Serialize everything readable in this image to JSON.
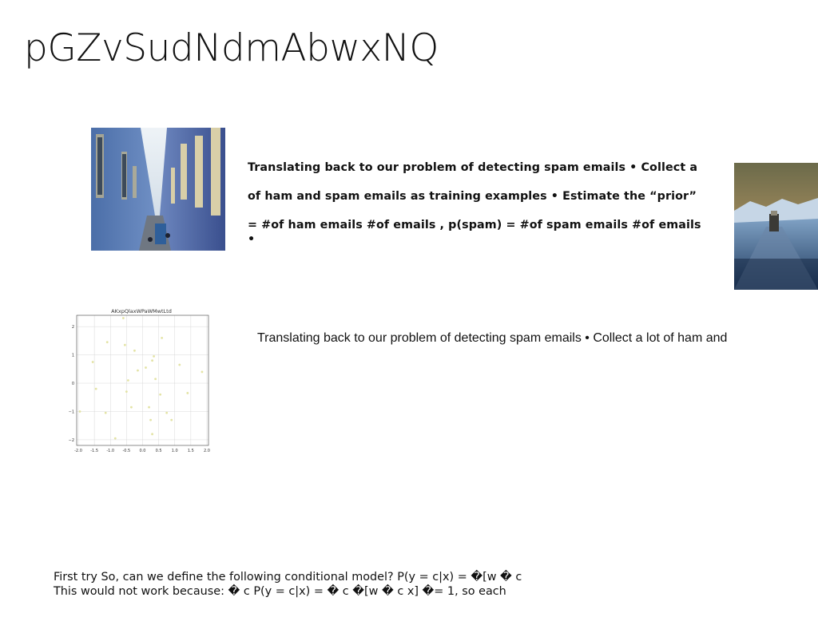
{
  "slide": {
    "title": "pGZvSudNdmAbwxNQ",
    "bold_lines": [
      "Translating back to our problem of detecting spam emails • Collect a",
      "of ham and spam emails as training examples • Estimate the “prior”",
      "= #of ham emails #of emails , p(spam) = #of spam emails #of emails •"
    ],
    "plain_text": "Translating back to our problem of detecting spam emails • Collect a lot of ham and",
    "footer_lines": [
      "First try So, can we define the following conditional model? P(y = c|x) = �[w � c",
      "This would not work because: � c P(y = c|x) = � c �[w � c x] �= 1, so each"
    ],
    "images": [
      {
        "name": "street-photo",
        "description_icon": "photo-icon"
      },
      {
        "name": "road-photo",
        "description_icon": "photo-icon"
      }
    ]
  },
  "chart_data": {
    "type": "scatter",
    "title": "AKxpQlaxWPaWMwtLtd",
    "xlim": [
      -2.05,
      2.05
    ],
    "ylim": [
      -2.2,
      2.4
    ],
    "xticks": [
      "-2.0",
      "-1.5",
      "-1.0",
      "-0.5",
      "0.0",
      "0.5",
      "1.0",
      "1.5",
      "2.0"
    ],
    "xtick_values": [
      -2.0,
      -1.5,
      -1.0,
      -0.5,
      0.0,
      0.5,
      1.0,
      1.5,
      2.0
    ],
    "yticks": [
      "2",
      "1",
      "0",
      "−1",
      "−2"
    ],
    "ytick_values": [
      2,
      1,
      0,
      -1,
      -2
    ],
    "grid": true,
    "point_color": "#e3e3a4",
    "points": [
      {
        "x": -1.95,
        "y": -1.0
      },
      {
        "x": -1.55,
        "y": 0.75
      },
      {
        "x": -1.45,
        "y": -0.2
      },
      {
        "x": -1.15,
        "y": -1.05
      },
      {
        "x": -1.1,
        "y": 1.45
      },
      {
        "x": -0.85,
        "y": -1.95
      },
      {
        "x": -0.6,
        "y": 2.3
      },
      {
        "x": -0.55,
        "y": 1.35
      },
      {
        "x": -0.5,
        "y": -0.3
      },
      {
        "x": -0.45,
        "y": 0.1
      },
      {
        "x": -0.35,
        "y": -0.85
      },
      {
        "x": -0.25,
        "y": 1.15
      },
      {
        "x": -0.15,
        "y": 0.45
      },
      {
        "x": 0.1,
        "y": 0.55
      },
      {
        "x": 0.2,
        "y": -0.85
      },
      {
        "x": 0.25,
        "y": -1.3
      },
      {
        "x": 0.3,
        "y": -1.8
      },
      {
        "x": 0.3,
        "y": 0.8
      },
      {
        "x": 0.35,
        "y": 0.95
      },
      {
        "x": 0.4,
        "y": 0.15
      },
      {
        "x": 0.55,
        "y": -0.4
      },
      {
        "x": 0.6,
        "y": 1.6
      },
      {
        "x": 0.75,
        "y": -1.05
      },
      {
        "x": 0.9,
        "y": -1.3
      },
      {
        "x": 1.15,
        "y": 0.65
      },
      {
        "x": 1.4,
        "y": -0.35
      },
      {
        "x": 1.85,
        "y": 0.4
      }
    ]
  }
}
